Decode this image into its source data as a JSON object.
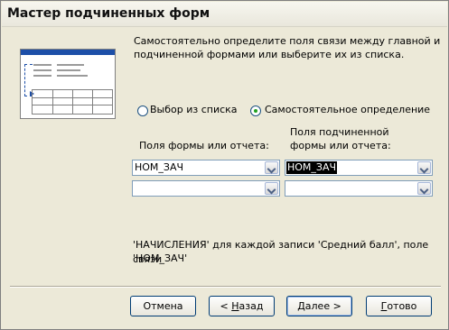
{
  "window": {
    "title": "Мастер подчиненных форм"
  },
  "instructions": {
    "line1": "Самостоятельно определите поля связи между главной и",
    "line2": "подчиненной формами или выберите их из списка."
  },
  "options": {
    "from_list": "Выбор из списка",
    "self_defined": "Самостоятельное определение",
    "selected": "self_defined"
  },
  "fields": {
    "form_label": "Поля формы или отчета:",
    "subform_label_line1": "Поля подчиненной",
    "subform_label_line2": "формы или отчета:",
    "form_field1_value": "НОМ_ЗАЧ",
    "form_field2_value": "",
    "subform_field1_value": "НОМ_ЗАЧ",
    "subform_field2_value": ""
  },
  "summary": {
    "line1": "'НАЧИСЛЕНИЯ' для каждой записи 'Средний балл', поле связи",
    "line2": "'НОМ_ЗАЧ'"
  },
  "buttons": {
    "cancel": "Отмена",
    "back_prefix": "< ",
    "back_hotkey": "Н",
    "back_rest": "азад",
    "next_hotkey": "Д",
    "next_rest": "алее >",
    "finish_hotkey": "Г",
    "finish_rest": "отово"
  }
}
